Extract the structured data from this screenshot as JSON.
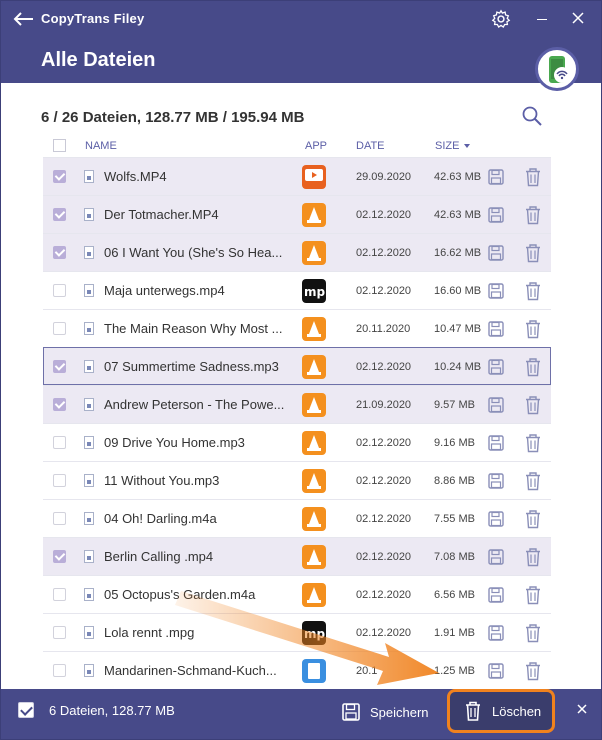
{
  "app": {
    "title": "CopyTrans Filey"
  },
  "header": {
    "title": "Alle Dateien"
  },
  "summary": "6 / 26 Dateien, 128.77 MB / 195.94 MB",
  "columns": {
    "name": "NAME",
    "app": "APP",
    "date": "DATE",
    "size": "SIZE"
  },
  "files": [
    {
      "name": "Wolfs.MP4",
      "app": "player-icon",
      "date": "29.09.2020",
      "size": "42.63 MB",
      "selected": true
    },
    {
      "name": "Der Totmacher.MP4",
      "app": "vlc-icon",
      "date": "02.12.2020",
      "size": "42.63 MB",
      "selected": true
    },
    {
      "name": "06 I Want You (She's So Hea...",
      "app": "vlc-icon",
      "date": "02.12.2020",
      "size": "16.62 MB",
      "selected": true
    },
    {
      "name": "Maja unterwegs.mp4",
      "app": "mp-icon",
      "date": "02.12.2020",
      "size": "16.60 MB",
      "selected": false
    },
    {
      "name": "The Main Reason Why Most ...",
      "app": "vlc-icon",
      "date": "20.11.2020",
      "size": "10.47 MB",
      "selected": false
    },
    {
      "name": "07 Summertime Sadness.mp3",
      "app": "vlc-icon",
      "date": "02.12.2020",
      "size": "10.24 MB",
      "selected": true
    },
    {
      "name": "Andrew Peterson - The Powe...",
      "app": "vlc-icon",
      "date": "21.09.2020",
      "size": "9.57 MB",
      "selected": true
    },
    {
      "name": "09 Drive You Home.mp3",
      "app": "vlc-icon",
      "date": "02.12.2020",
      "size": "9.16 MB",
      "selected": false
    },
    {
      "name": "11 Without You.mp3",
      "app": "vlc-icon",
      "date": "02.12.2020",
      "size": "8.86 MB",
      "selected": false
    },
    {
      "name": "04 Oh! Darling.m4a",
      "app": "vlc-icon",
      "date": "02.12.2020",
      "size": "7.55 MB",
      "selected": false
    },
    {
      "name": "Berlin Calling .mp4",
      "app": "vlc-icon",
      "date": "02.12.2020",
      "size": "7.08 MB",
      "selected": true
    },
    {
      "name": "05 Octopus's Garden.m4a",
      "app": "vlc-icon",
      "date": "02.12.2020",
      "size": "6.56 MB",
      "selected": false
    },
    {
      "name": "Lola rennt .mpg",
      "app": "mp-icon",
      "date": "02.12.2020",
      "size": "1.91 MB",
      "selected": false
    },
    {
      "name": "Mandarinen-Schmand-Kuch...",
      "app": "doc-icon",
      "date": "20.1",
      "size": "1.25 MB",
      "selected": false
    }
  ],
  "footer": {
    "status": "6 Dateien, 128.77 MB",
    "save_label": "Speichern",
    "delete_label": "Löschen"
  },
  "colors": {
    "primary": "#474a89",
    "selected_row": "#ece9f3",
    "highlight": "#f0821e"
  }
}
